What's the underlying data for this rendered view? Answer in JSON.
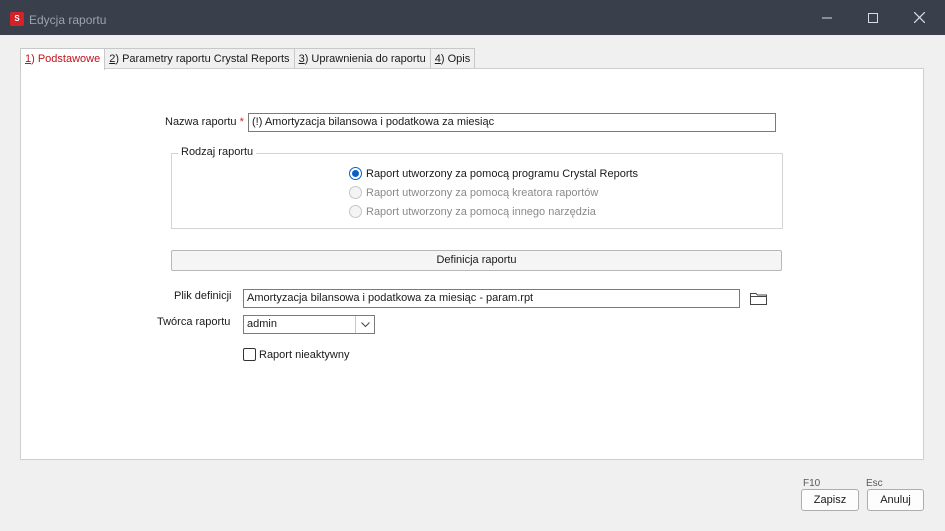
{
  "window": {
    "title": "Edycja raportu",
    "app_icon_text": "S"
  },
  "tabs": [
    {
      "key": "1",
      "label": ") Podstawowe",
      "active": true
    },
    {
      "key": "2",
      "label": ") Parametry raportu Crystal Reports",
      "active": false
    },
    {
      "key": "3",
      "label": ") Uprawnienia do raportu",
      "active": false
    },
    {
      "key": "4",
      "label": ") Opis",
      "active": false
    }
  ],
  "form": {
    "report_name_label": "Nazwa raportu",
    "required_marker": "*",
    "report_name_value": "(!) Amortyzacja bilansowa i podatkowa za miesiąc",
    "report_type": {
      "title": "Rodzaj raportu",
      "options": [
        {
          "label": "Raport utworzony za pomocą programu Crystal Reports",
          "checked": true,
          "enabled": true
        },
        {
          "label": "Raport utworzony za pomocą kreatora raportów",
          "checked": false,
          "enabled": false
        },
        {
          "label": "Raport utworzony za pomocą innego narzędzia",
          "checked": false,
          "enabled": false
        }
      ]
    },
    "definition_button": "Definicja raportu",
    "definition_file_label": "Plik definicji",
    "definition_file_value": "Amortyzacja bilansowa i podatkowa za miesiąc - param.rpt",
    "author_label": "Twórca raportu",
    "author_value": "admin",
    "inactive_label": "Raport nieaktywny",
    "inactive_checked": false
  },
  "footer": {
    "save_shortcut": "F10",
    "save_label": "Zapisz",
    "cancel_shortcut": "Esc",
    "cancel_label": "Anuluj"
  },
  "colors": {
    "titlebar": "#39404b",
    "accent_red": "#d2232a",
    "radio_blue": "#0a5fc6"
  }
}
